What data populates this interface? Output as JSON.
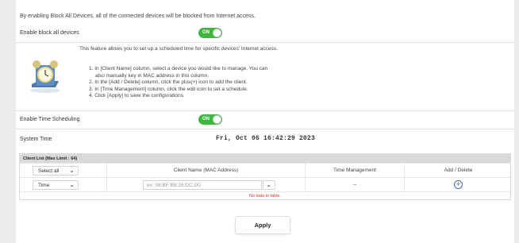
{
  "intro_text": "By enabling Block All Devices, all of the connected devices will be blocked from Internet access.",
  "block_all": {
    "label": "Enable block all devices",
    "toggle": "ON"
  },
  "feature": {
    "description": "This feature allows you to set up a scheduled time for specific devices' Internet access.",
    "steps": [
      "1. In [Client Name] column, select a device you would like to manage. You can",
      "also manually key in MAC address in this column.",
      "2. In the [Add / Delete] column, click the plus(+) icon to add the client.",
      "3. In [Time Management] column, click the edit icon to set a schedule.",
      "4. Click [Apply] to save the configurations."
    ],
    "icon": "alarm-clock-icon"
  },
  "scheduling": {
    "label": "Enable Time Scheduling",
    "toggle": "ON"
  },
  "system_time": {
    "label": "System Time",
    "value": "Fri, Oct 06 16:42:29 2023"
  },
  "client_list": {
    "caption": "Client List (Max Limit : 64)",
    "header": {
      "filter_select": "Select all",
      "client_name": "Client Name (MAC Address)",
      "time_management": "Time Management",
      "add_delete": "Add / Delete"
    },
    "input_row": {
      "mode_select": "Time",
      "mac_placeholder": "ex: 08:BF:B8:26:DC:D0",
      "time_management": "--"
    },
    "empty_text": "No data in table."
  },
  "apply_label": "Apply",
  "colors": {
    "toggle_on": "#3cb83c",
    "accent_blue": "#3a66d6",
    "error_red": "#e03030"
  }
}
